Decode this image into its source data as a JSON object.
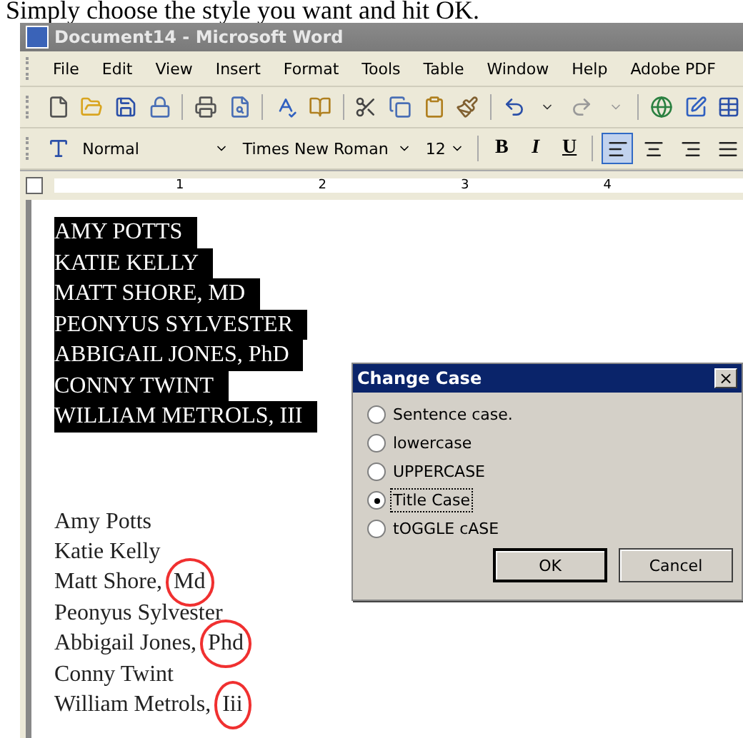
{
  "caption": "Simply choose the style you want and hit OK.",
  "window": {
    "title": "Document14 - Microsoft Word"
  },
  "menu": [
    "File",
    "Edit",
    "View",
    "Insert",
    "Format",
    "Tools",
    "Table",
    "Window",
    "Help",
    "Adobe PDF"
  ],
  "formatting": {
    "style": "Normal",
    "font": "Times New Roman",
    "size": "12",
    "bold": "B",
    "italic": "I",
    "underline": "U",
    "align": [
      {
        "kind": "left",
        "selected": true
      },
      {
        "kind": "center",
        "selected": false
      },
      {
        "kind": "right",
        "selected": false
      },
      {
        "kind": "justify",
        "selected": false
      }
    ]
  },
  "ruler": [
    "1",
    "2",
    "3",
    "4"
  ],
  "selected_lines": [
    "AMY POTTS",
    "KATIE KELLY",
    "MATT SHORE, MD",
    "PEONYUS SYLVESTER",
    "ABBIGAIL JONES, PhD",
    "CONNY TWINT",
    "WILLIAM METROLS, III"
  ],
  "lines": [
    {
      "text": "Amy Potts"
    },
    {
      "text": "Katie Kelly"
    },
    {
      "text": "Matt Shore,",
      "circled": "Md"
    },
    {
      "text": "Peonyus Sylvester"
    },
    {
      "text": "Abbigail Jones,",
      "circled": "Phd"
    },
    {
      "text": "Conny Twint"
    },
    {
      "text": "William Metrols,",
      "circled": "Iii"
    }
  ],
  "dialog": {
    "title": "Change Case",
    "close": "×",
    "options": [
      {
        "label": "Sentence case.",
        "selected": false
      },
      {
        "label": "lowercase",
        "selected": false
      },
      {
        "label": "UPPERCASE",
        "selected": false
      },
      {
        "label": "Title Case",
        "selected": true
      },
      {
        "label": "tOGGLE cASE",
        "selected": false
      }
    ],
    "buttons": [
      {
        "label": "OK",
        "kind": "default"
      },
      {
        "label": "Cancel",
        "kind": "normal"
      }
    ]
  }
}
